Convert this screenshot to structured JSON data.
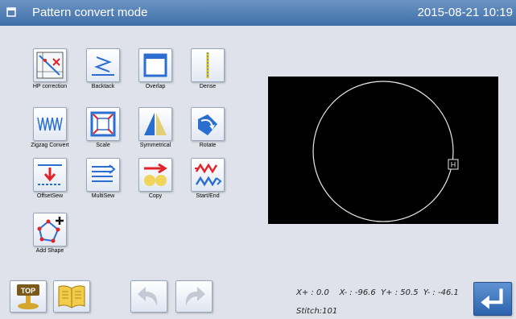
{
  "header": {
    "title": "Pattern convert mode",
    "datetime": "2015-08-21 10:19"
  },
  "tools": [
    {
      "label": "HP correction"
    },
    {
      "label": "Backtack"
    },
    {
      "label": "Overlap"
    },
    {
      "label": "Dense"
    },
    {
      "label": "Zigzag Convert"
    },
    {
      "label": "Scale"
    },
    {
      "label": "Symmetrical"
    },
    {
      "label": "Rotate"
    },
    {
      "label": "OffsetSew"
    },
    {
      "label": "MultiSew"
    },
    {
      "label": "Copy"
    },
    {
      "label": "Start/End"
    },
    {
      "label": "Add Shape"
    }
  ],
  "bottom": {
    "top_label": "TOP"
  },
  "status": {
    "coords": "X+ : 0.0    X- : -96.6  Y+ : 50.5  Y- : -46.1",
    "stitch": "Stitch:101"
  },
  "preview": {
    "marker": "H"
  },
  "colors": {
    "accent": "#4f7fb8",
    "blue_icon": "#2a6fd0",
    "red_icon": "#e0242a"
  }
}
